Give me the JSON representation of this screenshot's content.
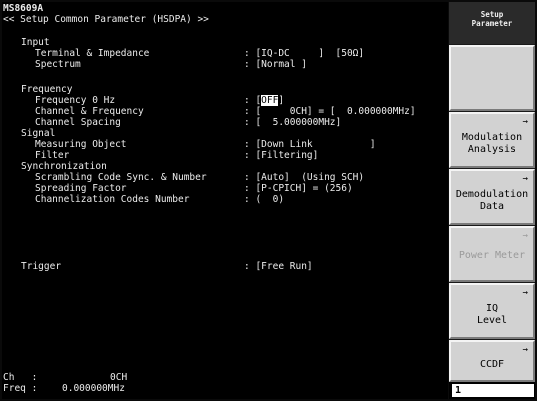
{
  "header": {
    "model": "MS8609A",
    "title": "<< Setup Common Parameter (HSDPA) >>"
  },
  "input": {
    "heading": "Input",
    "terminal_label": "Terminal & Impedance",
    "terminal_value": ": [IQ-DC     ]  [50Ω]",
    "spectrum_label": "Spectrum",
    "spectrum_value": ": [Normal ]"
  },
  "frequency": {
    "heading": "Frequency",
    "freq0_label": "Frequency 0 Hz",
    "freq0_prefix": ": [",
    "freq0_value": "OFF",
    "freq0_suffix": "]",
    "channel_label": "Channel & Frequency",
    "channel_value": ": [     0CH] = [  0.000000MHz]",
    "spacing_label": "Channel Spacing",
    "spacing_value": ": [  5.000000MHz]"
  },
  "signal": {
    "heading": "Signal",
    "object_label": "Measuring Object",
    "object_value": ": [Down Link          ]",
    "filter_label": "Filter",
    "filter_value": ": [Filtering]"
  },
  "sync": {
    "heading": "Synchronization",
    "scrambling_label": "Scrambling Code Sync. & Number",
    "scrambling_value": ": [Auto]  (Using SCH)",
    "spreading_label": "Spreading Factor",
    "spreading_value": ": [P-CPICH] = (256)",
    "channelization_label": "Channelization Codes Number",
    "channelization_value": ": (  0)"
  },
  "trigger": {
    "label": "Trigger",
    "value": ": [Free Run]"
  },
  "footer": {
    "ch_label": "Ch   :",
    "ch_value": "0CH",
    "freq_label": "Freq :",
    "freq_value": "0.000000MHz"
  },
  "softkeys": {
    "title_line1": "Setup",
    "title_line2": "Parameter",
    "modulation": "Modulation\nAnalysis",
    "demodulation": "Demodulation\nData",
    "power_meter": "Power Meter",
    "iq_level": "IQ\nLevel",
    "ccdf": "CCDF",
    "arrow": "→",
    "page": "1"
  }
}
